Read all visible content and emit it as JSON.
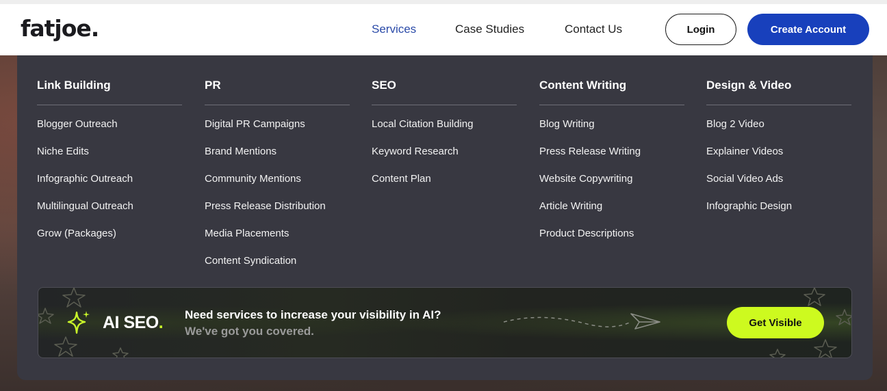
{
  "header": {
    "logo": "fatjoe.",
    "nav": [
      {
        "label": "Services",
        "active": true
      },
      {
        "label": "Case Studies",
        "active": false
      },
      {
        "label": "Contact Us",
        "active": false
      }
    ],
    "login_label": "Login",
    "create_account_label": "Create Account"
  },
  "menu": {
    "columns": [
      {
        "title": "Link Building",
        "items": [
          "Blogger Outreach",
          "Niche Edits",
          "Infographic Outreach",
          "Multilingual Outreach",
          "Grow (Packages)"
        ]
      },
      {
        "title": "PR",
        "items": [
          "Digital PR Campaigns",
          "Brand Mentions",
          "Community Mentions",
          "Press Release Distribution",
          "Media Placements",
          "Content Syndication"
        ]
      },
      {
        "title": "SEO",
        "items": [
          "Local Citation Building",
          "Keyword Research",
          "Content Plan"
        ]
      },
      {
        "title": "Content Writing",
        "items": [
          "Blog Writing",
          "Press Release Writing",
          "Website Copywriting",
          "Article Writing",
          "Product Descriptions"
        ]
      },
      {
        "title": "Design & Video",
        "items": [
          "Blog 2 Video",
          "Explainer Videos",
          "Social Video Ads",
          "Infographic Design"
        ]
      }
    ]
  },
  "banner": {
    "logo_text": "AI SEO",
    "logo_dot": ".",
    "headline": "Need services to increase your visibility in AI?",
    "subline": "We've got you covered.",
    "cta_label": "Get Visible",
    "icons": [
      "sparkle-icon",
      "paper-plane-icon",
      "star-outline-icon"
    ]
  },
  "colors": {
    "brand_blue": "#1840bc",
    "menu_bg": "#383841",
    "accent_lime": "#cdfa1f",
    "nav_active": "#2a4aa8"
  }
}
